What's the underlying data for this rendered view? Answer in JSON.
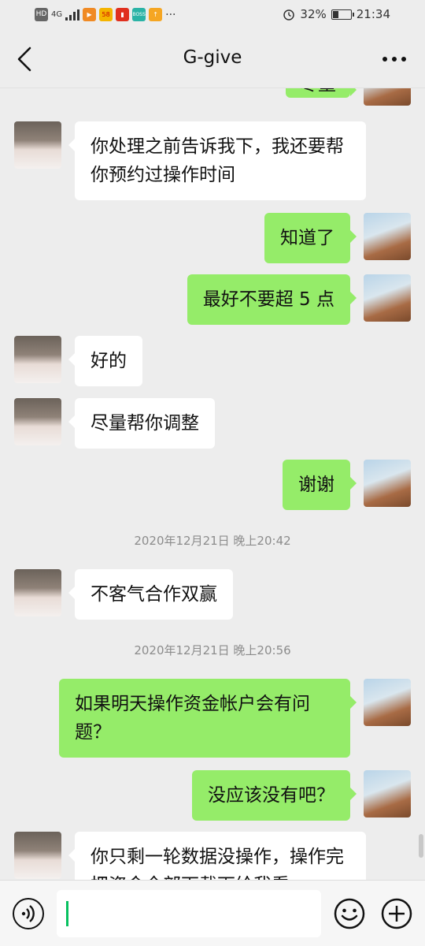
{
  "status_bar": {
    "network": "4G",
    "app_badge": "58",
    "boss_badge": "BOSS",
    "dots": "···",
    "battery": "32%",
    "battery_level": 0.32,
    "time": "21:34"
  },
  "header": {
    "title": "G-give"
  },
  "messages": [
    {
      "side": "out",
      "text": "尽量",
      "partial": true
    },
    {
      "side": "in",
      "text": "你处理之前告诉我下，我还要帮你预约过操作时间"
    },
    {
      "side": "out",
      "text": "知道了"
    },
    {
      "side": "out",
      "text": "最好不要超 5 点"
    },
    {
      "side": "in",
      "text": "好的"
    },
    {
      "side": "in",
      "text": "尽量帮你调整"
    },
    {
      "side": "out",
      "text": "谢谢"
    },
    {
      "type": "timestamp",
      "text": "2020年12月21日 晚上20:42"
    },
    {
      "side": "in",
      "text": "不客气合作双赢"
    },
    {
      "type": "timestamp",
      "text": "2020年12月21日 晚上20:56"
    },
    {
      "side": "out",
      "text": "如果明天操作资金帐户会有问题？"
    },
    {
      "side": "out",
      "text": "没应该没有吧？"
    },
    {
      "side": "in",
      "text": "你只剩一轮数据没操作，操作完把资金全部下载下给我看",
      "partial": true
    }
  ],
  "input_bar": {
    "placeholder": "",
    "value": ""
  },
  "icons": {
    "back": "chevron-left-icon",
    "more": "more-icon",
    "voice": "voice-icon",
    "emoji": "emoji-icon",
    "add": "add-icon"
  },
  "colors": {
    "background": "#ededed",
    "outgoing_bubble": "#95ec69",
    "incoming_bubble": "#ffffff",
    "cursor": "#07c160"
  }
}
